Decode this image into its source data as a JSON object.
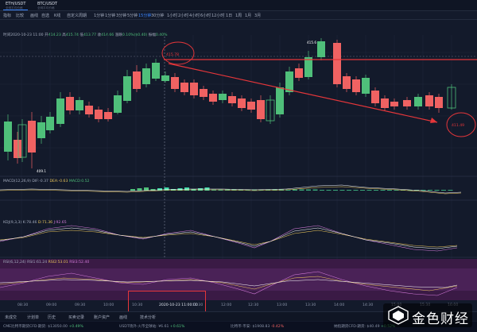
{
  "tabs": [
    {
      "title": "ETH/USDT",
      "sub": "全网平均价格"
    },
    {
      "title": "BTC/USDT",
      "sub": "全网平均价格"
    }
  ],
  "toolbar": {
    "items": [
      "指标",
      "比较",
      "画线",
      "自选",
      "K线",
      "自定义周期",
      "1分钟",
      "1分钟",
      "3分钟",
      "5分钟",
      "15分钟",
      "30分钟",
      "1小时",
      "2小时",
      "4小时",
      "6小时",
      "12小时",
      "1日",
      "1周",
      "1月",
      "3月"
    ],
    "active_index": 10
  },
  "ohlc": {
    "time_label": "时间",
    "time": "2020-10-23 11:00",
    "open_label": "开",
    "open": "414.23",
    "high_label": "高",
    "high": "415.74",
    "low_label": "低",
    "low": "413.77",
    "close_label": "收",
    "close": "414.66",
    "change_label": "涨跌",
    "change": "0.10%($0.40)",
    "amp_label": "振幅",
    "amp": "0.40%"
  },
  "price_annotations": {
    "high_marker": "415.6",
    "low_marker": "409.1",
    "circle1": "415.78",
    "circle2": "411.49"
  },
  "macd": {
    "name": "MACD(12,26,9)",
    "dif_label": "DIF:",
    "dif": "-0.37",
    "dea_label": "DEA:",
    "dea": "-0.63",
    "macd_label": "MACD:",
    "macd": "0.52"
  },
  "kdj": {
    "name": "KDJ(9,3,3)",
    "k_label": "K:",
    "k": "78.46",
    "d_label": "D:",
    "d": "71.36",
    "j_label": "J:",
    "j": "92.65"
  },
  "rsi": {
    "name": "RSI(6,12,24)",
    "r1_label": "RSI1:",
    "r1": "61.24",
    "r2_label": "RSI2:",
    "r2": "53.01",
    "r3_label": "RSI3:",
    "r3": "52.40"
  },
  "time_axis": [
    "08:30",
    "09:00",
    "09:30",
    "10:00",
    "10:30",
    "2020-10-23 11:00:00",
    "11:30",
    "12:00",
    "12:30",
    "13:00",
    "13:30",
    "14:00",
    "14:30",
    "15:00",
    "15:30",
    "16:00"
  ],
  "bottom_tabs": [
    "未成交",
    "计划单",
    "历史",
    "买卖记录",
    "账户资产",
    "画线",
    "技术分析"
  ],
  "ticker": [
    {
      "label": "CME比特币期货CFD·期货:",
      "value": "$13050.00",
      "change": "+0.49%",
      "dir": "up"
    },
    {
      "label": "USDT场外·火币全球站:",
      "value": "¥6.61",
      "change": "+0.61%",
      "dir": "up"
    },
    {
      "label": "比特币·币安:",
      "value": "$1908.83",
      "change": "-0.42%",
      "dir": "dn"
    },
    {
      "label": "纳指期货CFD·期货:",
      "value": "$40.49",
      "change": "+0.52%",
      "dir": "up"
    }
  ],
  "logo": {
    "text": "金色财经"
  },
  "colors": {
    "up": "#4fbf7a",
    "down": "#f06262",
    "bg": "#131a2b",
    "annotation": "#e5363a"
  }
}
